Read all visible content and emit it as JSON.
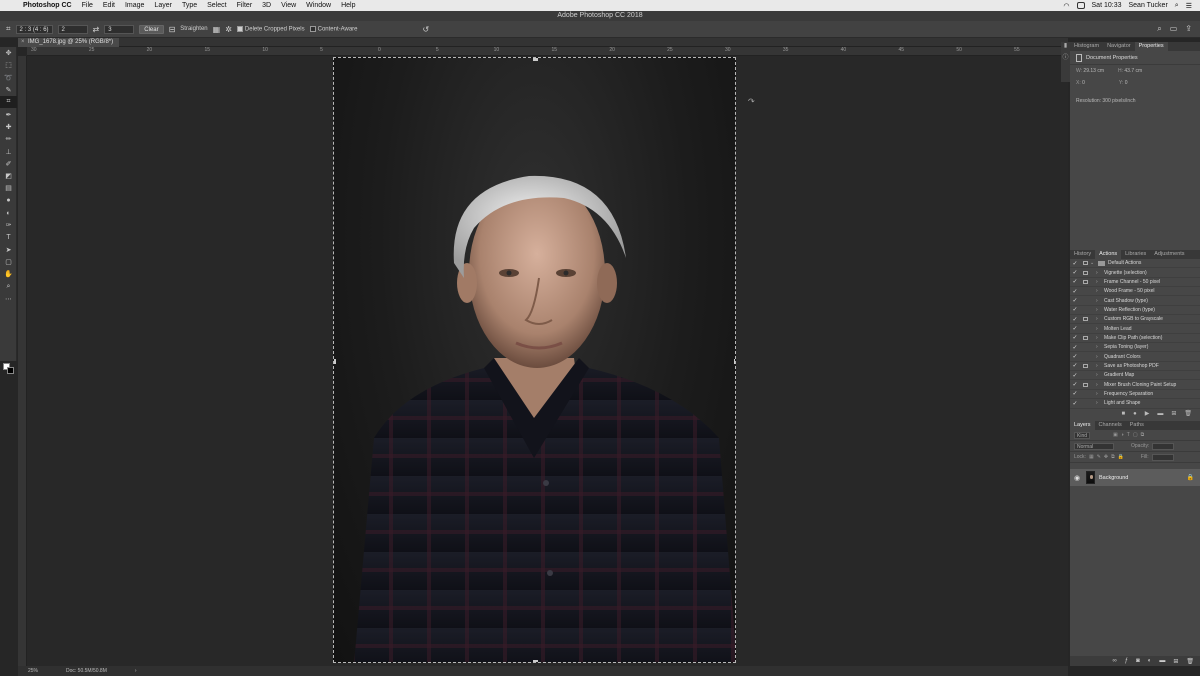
{
  "menubar": {
    "app": "Photoshop CC",
    "items": [
      "File",
      "Edit",
      "Image",
      "Layer",
      "Type",
      "Select",
      "Filter",
      "3D",
      "View",
      "Window",
      "Help"
    ],
    "clock": "Sat 10:33",
    "user": "Sean Tucker"
  },
  "window": {
    "title": "Adobe Photoshop CC 2018"
  },
  "options": {
    "ratio": "2 : 3 (4 : 6)",
    "width": "2",
    "height": "3",
    "clear": "Clear",
    "straighten": "Straighten",
    "delete_cropped": "Delete Cropped Pixels",
    "content_aware": "Content-Aware"
  },
  "document": {
    "tab": "IMG_1678.jpg @ 25% (RGB/8*)",
    "ruler_ticks": [
      "30",
      "25",
      "20",
      "15",
      "10",
      "5",
      "0",
      "5",
      "10",
      "15",
      "20",
      "25",
      "30",
      "35",
      "40",
      "45",
      "50",
      "55"
    ]
  },
  "status": {
    "zoom": "25%",
    "doc": "Doc: 50.5M/50.8M"
  },
  "properties": {
    "tabs": [
      "Histogram",
      "Navigator",
      "Properties"
    ],
    "heading": "Document Properties",
    "w_label": "W:",
    "w_value": "29.13 cm",
    "h_label": "H:",
    "h_value": "43.7 cm",
    "x_label": "X:",
    "x_value": "0",
    "y_label": "Y:",
    "y_value": "0",
    "resolution": "Resolution: 300 pixels/inch"
  },
  "actions": {
    "tabs": [
      "History",
      "Actions",
      "Libraries",
      "Adjustments"
    ],
    "set_name": "Default Actions",
    "items": [
      "Vignette (selection)",
      "Frame Channel - 50 pixel",
      "Wood Frame - 50 pixel",
      "Cast Shadow (type)",
      "Water Reflection (type)",
      "Custom RGB to Grayscale",
      "Molten Lead",
      "Make Clip Path (selection)",
      "Sepia Toning (layer)",
      "Quadrant Colors",
      "Save as Photoshop PDF",
      "Gradient Map",
      "Mixer Brush Cloning Paint Setup",
      "Frequency Separation",
      "Light and Shape"
    ]
  },
  "layers": {
    "tabs": [
      "Layers",
      "Channels",
      "Paths"
    ],
    "kind": "Kind",
    "mode": "Normal",
    "opacity_label": "Opacity:",
    "lock_label": "Lock:",
    "fill_label": "Fill:",
    "layer_name": "Background"
  },
  "colors": {
    "accent": "#474747",
    "canvas": "#282828",
    "selected_layer": "#5c5c5c"
  }
}
